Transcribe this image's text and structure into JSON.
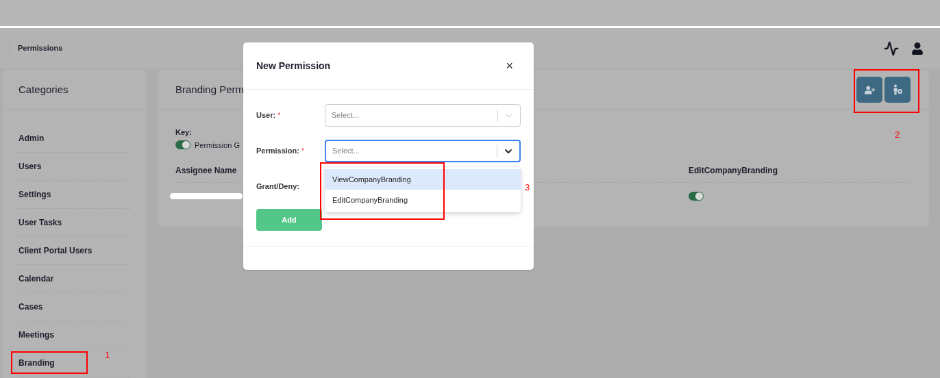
{
  "header": {
    "title": "Permissions"
  },
  "sidebar": {
    "title": "Categories",
    "items": [
      {
        "label": "Admin"
      },
      {
        "label": "Users"
      },
      {
        "label": "Settings"
      },
      {
        "label": "User Tasks"
      },
      {
        "label": "Client Portal Users"
      },
      {
        "label": "Calendar"
      },
      {
        "label": "Cases"
      },
      {
        "label": "Meetings"
      },
      {
        "label": "Branding"
      }
    ]
  },
  "main": {
    "title": "Branding Perm",
    "key_label": "Key:",
    "key_item": {
      "label": "Permission G",
      "on": true
    },
    "columns": [
      "Assignee Name",
      "EditCompanyBranding"
    ],
    "rows": [
      {
        "granted": true
      }
    ]
  },
  "modal": {
    "title": "New Permission",
    "close": "×",
    "fields": [
      {
        "label": "User:",
        "required_mark": "*",
        "kind": "select",
        "placeholder": "Select...",
        "focused": false
      },
      {
        "label": "Permission:",
        "required_mark": "*",
        "kind": "select",
        "placeholder": "Select...",
        "focused": true
      },
      {
        "label": "Grant/Deny:",
        "kind": "empty"
      }
    ],
    "options": [
      {
        "label": "ViewCompanyBranding",
        "selected": true
      },
      {
        "label": "EditCompanyBranding",
        "selected": false
      }
    ],
    "add_button": "Add"
  },
  "annotations": [
    {
      "label": "1"
    },
    {
      "label": "2"
    },
    {
      "label": "3"
    }
  ]
}
